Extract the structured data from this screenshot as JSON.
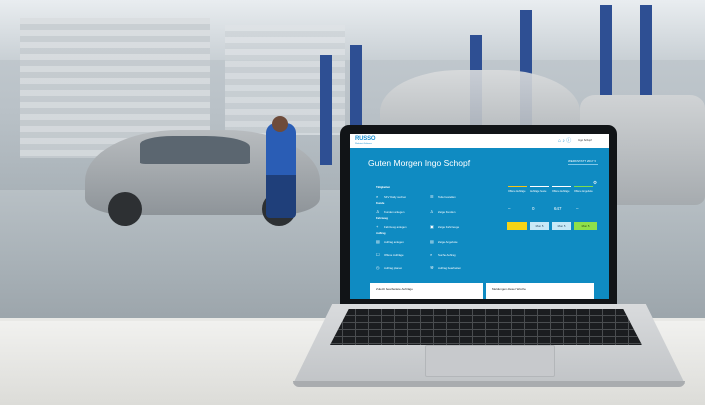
{
  "app": {
    "logo": "RUSSO",
    "logo_sub": "Werkstatt Software",
    "toolbar_icons": "⌂ ♪ ⓘ",
    "user": "Ingo Schopf",
    "greeting": "Guten Morgen Ingo Schopf",
    "header_right": "WERKSTATT 2017 ▾"
  },
  "menu": {
    "sections": [
      "Tätigkeiten",
      "Kunde",
      "Fahrzeug",
      "Auftrag"
    ],
    "items": [
      {
        "icon": "magnifier-icon",
        "glyph": "⌕",
        "label": "SFV Daily suchen"
      },
      {
        "icon": "list-icon",
        "glyph": "☰",
        "label": "Teile bestellen"
      },
      {
        "icon": "user-icon",
        "glyph": "♙",
        "label": "Kunden anlegen"
      },
      {
        "icon": "user-list-icon",
        "glyph": "♙",
        "label": "Zeige Kunden"
      },
      {
        "icon": "plus-icon",
        "glyph": "+",
        "label": "Fahrzeug anlegen"
      },
      {
        "icon": "car-icon",
        "glyph": "▣",
        "label": "Zeige Fahrzeuge"
      },
      {
        "icon": "order-icon",
        "glyph": "▤",
        "label": "Auftrag anlegen"
      },
      {
        "icon": "offers-icon",
        "glyph": "▤",
        "label": "Zeige Angebote"
      },
      {
        "icon": "open-orders-icon",
        "glyph": "☐",
        "label": "Offene Aufträge"
      },
      {
        "icon": "search-order-icon",
        "glyph": "⌕",
        "label": "Suche Auftrag"
      },
      {
        "icon": "clock-icon",
        "glyph": "◷",
        "label": "Auftrag planen"
      },
      {
        "icon": "wrench-icon",
        "glyph": "⚒",
        "label": "Auftrag bearbeiten"
      }
    ]
  },
  "stats": [
    {
      "label": "Offene Aufträge",
      "value": "–",
      "color": "#f5c518"
    },
    {
      "label": "Aufträge heute",
      "value": "0",
      "color": "#ffffff"
    },
    {
      "label": "Offene Aufträge",
      "value": "647",
      "color": "#ffffff"
    },
    {
      "label": "Offene Angebote",
      "value": "–",
      "color": "#7ddc4f"
    }
  ],
  "chips": [
    {
      "label": "",
      "bg": "#f5d416"
    },
    {
      "label": "Mon 5",
      "bg": "#c8e9f7"
    },
    {
      "label": "Mon 5",
      "bg": "#c8e9f7"
    },
    {
      "label": "Mon 5",
      "bg": "#8ee04a"
    }
  ],
  "cards": [
    {
      "title": "Zuletzt bearbeitete Aufträge"
    },
    {
      "title": "Meldungen dieser Woche"
    }
  ]
}
